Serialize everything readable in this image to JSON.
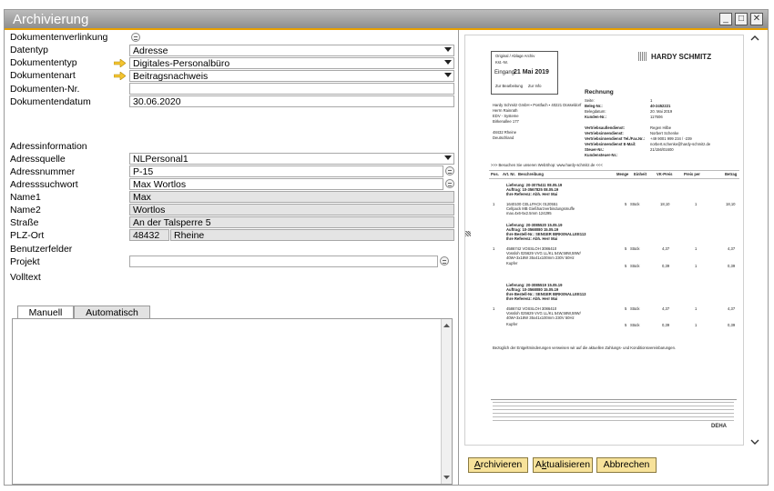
{
  "window": {
    "title": "Archivierung"
  },
  "form": {
    "dokumentenverlinkung": "Dokumentenverlinkung",
    "datentyp_label": "Datentyp",
    "datentyp_value": "Adresse",
    "dokumententyp_label": "Dokumententyp",
    "dokumententyp_value": "Digitales-Personalbüro",
    "dokumentenart_label": "Dokumentenart",
    "dokumentenart_value": "Beitragsnachweis",
    "dokumentennr_label": "Dokumenten-Nr.",
    "dokumentennr_value": "",
    "dokumentendatum_label": "Dokumentendatum",
    "dokumentendatum_value": "30.06.2020",
    "adressinformation": "Adressinformation",
    "adressquelle_label": "Adressquelle",
    "adressquelle_value": "NLPersonal1",
    "adressnummer_label": "Adressnummer",
    "adressnummer_value": "P-15",
    "adresssuchwort_label": "Adresssuchwort",
    "adresssuchwort_value": "Max Wortlos",
    "name1_label": "Name1",
    "name1_value": "Max",
    "name2_label": "Name2",
    "name2_value": "Wortlos",
    "strasse_label": "Straße",
    "strasse_value": "An der Talsperre 5",
    "plzort_label": "PLZ-Ort",
    "plz_value": "48432",
    "ort_value": "Rheine",
    "benutzerfelder": "Benutzerfelder",
    "projekt_label": "Projekt",
    "projekt_value": "",
    "volltext": "Volltext"
  },
  "tabs": [
    {
      "label": "Manuell"
    },
    {
      "label": "Automatisch"
    }
  ],
  "buttons": {
    "archivieren": {
      "u": "A",
      "rest": "rchivieren"
    },
    "aktualisieren_pre": "A",
    "aktualisieren_u": "k",
    "aktualisieren_rest": "tualisieren",
    "abbrechen": "Abbrechen"
  },
  "document": {
    "logo": "HARDY SCHMITZ",
    "stamp_top": "Eingang",
    "stamp_date": "21 Mai 2019",
    "heading": "Rechnung",
    "webshop": ">>> Besuchen Sie unseren WebShop: www.hardy-schmitz.de <<<",
    "cols": [
      "Pos.",
      "Art. Nr.",
      "Beschreibung",
      "Menge",
      "Einheit",
      "VK-Preis",
      "Preis per",
      "Betrag"
    ],
    "blocks": [
      {
        "lief": "Lieferung: 20-3075411 08.05.19",
        "auf": "Auftrag: 10-3567825 08.05.19",
        "ref": "Ihre Referenz: Abh. Herr Mai",
        "items": [
          {
            "pos": "1",
            "art": "1640100  CELLPACK   0120551",
            "desc": "Cellpack MB Gießharzverbindungsmuffe",
            "desc2": "max.4x6-5x2.5mm 124295",
            "menge": "5",
            "einh": "Stück",
            "vk": "18,10",
            "per": "1",
            "betrag": "18,10"
          }
        ]
      },
      {
        "lief": "Lieferung: 20-3085520 15.05.19",
        "auf": "Auftrag: 10-3568080 15.05.19",
        "ref": "Ihre Bestell-Nr.: SENGER BIRKENALLEE113",
        "ref2": "Ihre Referenz: Abh. Herr Mai",
        "items": [
          {
            "pos": "1",
            "art": "4586742  VOSSLOH   3086410",
            "desc": "Vossloh 025629 VVG LL/KL 54W,58W,59W/",
            "desc2": "40W+3x18W 35x41x100mm 230V 50Hz",
            "menge": "5",
            "einh": "Stück",
            "vk": "4,37",
            "per": "1",
            "betrag": "4,37"
          },
          {
            "pos": "",
            "art": "",
            "desc": "Kupfer",
            "desc2": "",
            "menge": "5",
            "einh": "Stück",
            "vk": "0,39",
            "per": "1",
            "betrag": "0,39"
          }
        ]
      },
      {
        "lief": "Lieferung: 20-3085519 15.05.19",
        "auf": "Auftrag: 10-3568080 15.05.19",
        "ref": "Ihre Bestell-Nr.: SENGER BIRKENALLEE113",
        "ref2": "Ihre Referenz: Abh. Herr Mai",
        "items": [
          {
            "pos": "1",
            "art": "4586742  VOSSLOH   3086410",
            "desc": "Vossloh 025629 VVG LL/KL 54W,58W,59W/",
            "desc2": "40W+3x18W 35x41x100mm 230V 50Hz",
            "menge": "5",
            "einh": "Stück",
            "vk": "4,37",
            "per": "1",
            "betrag": "4,37"
          },
          {
            "pos": "",
            "art": "",
            "desc": "Kupfer",
            "desc2": "",
            "menge": "5",
            "einh": "Stück",
            "vk": "0,39",
            "per": "1",
            "betrag": "0,39"
          }
        ]
      }
    ],
    "footer_note": "Bezüglich der Entgeltminderungen verweisen wir auf die aktuellen Zahlungs- und Konditionsvereinbarungen.",
    "address": [
      "Hardy Schmitz GmbH ▪ Postfach ▪ 40221 Düsseldorf",
      "Herrn Rainrath",
      "EDV - Systeme",
      "Birkenallee 177",
      "",
      "48432 Rheine",
      "Deutschland"
    ],
    "meta_labels": [
      "Seite:",
      "Beleg-Nr.:",
      "Belegdatum:",
      "Kunden-Nr.:",
      "",
      "Vertriebsaußendienst:",
      "Vertriebsinnendienst:",
      "Vertriebsinnendienst Tel./Fax.Nr.:",
      "Vertriebsinnendienst E-Mail:",
      "Steuer-Nr.:",
      "Kundensteuer-Nr.:"
    ],
    "meta_values": [
      "1",
      "40-2452221",
      "20. Mai 2019",
      "117606",
      "",
      "Regen Hilbe",
      "Norbert Schenke",
      "+49 9001 999 234 / -239",
      "norbert.schenke@hardy-schmitz.de",
      "21/156/01600",
      ""
    ],
    "footer_brand": "DEHA"
  }
}
